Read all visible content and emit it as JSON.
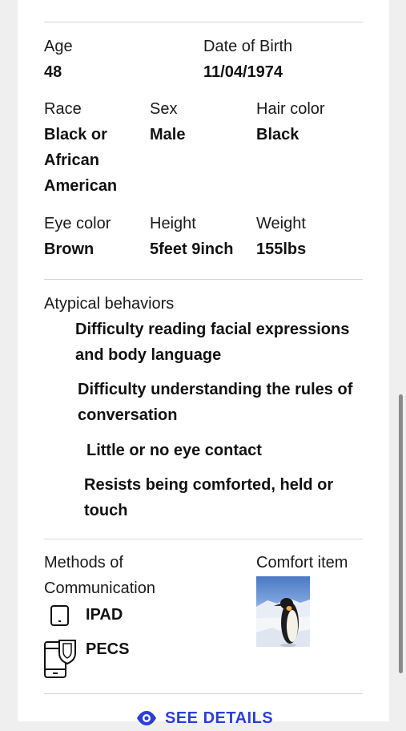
{
  "profile": {
    "age": {
      "label": "Age",
      "value": "48"
    },
    "dob": {
      "label": "Date of Birth",
      "value": "11/04/1974"
    },
    "race": {
      "label": "Race",
      "value_lines": [
        "Black or",
        "African",
        "American"
      ]
    },
    "sex": {
      "label": "Sex",
      "value": "Male"
    },
    "hair": {
      "label": "Hair color",
      "value": "Black"
    },
    "eye": {
      "label": "Eye color",
      "value": "Brown"
    },
    "height": {
      "label": "Height",
      "value": "5feet 9inch"
    },
    "weight": {
      "label": "Weight",
      "value": "155lbs"
    }
  },
  "behaviors": {
    "label": "Atypical behaviors",
    "items": [
      [
        "Difficulty reading facial expressions",
        "and body language"
      ],
      [
        "Difficulty understanding the rules of",
        "conversation"
      ],
      [
        "Little or no eye contact"
      ],
      [
        "Resists being comforted, held or",
        "touch"
      ]
    ]
  },
  "communication": {
    "label_lines": [
      "Methods of",
      "Communication"
    ],
    "methods": [
      {
        "label": "IPAD",
        "icon": "tablet-icon"
      },
      {
        "label": "PECS",
        "icon": "phone-cards-icon"
      }
    ]
  },
  "comfort": {
    "label": "Comfort item",
    "image": "penguin-photo"
  },
  "actions": {
    "see_details": "SEE DETAILS",
    "icon": "eye-icon"
  },
  "colors": {
    "link": "#2b3fd6",
    "divider": "#d4d4d4",
    "background": "#efefef"
  }
}
